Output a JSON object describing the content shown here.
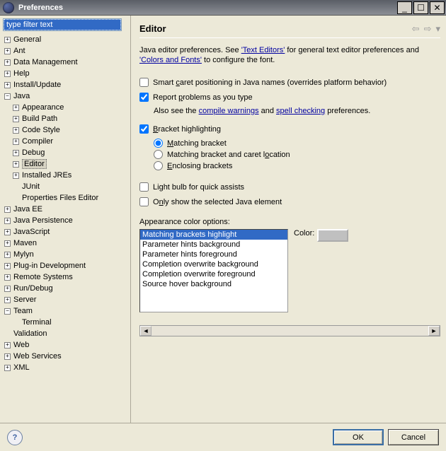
{
  "window": {
    "title": "Preferences"
  },
  "filter": {
    "value": "type filter text"
  },
  "tree": [
    {
      "label": "General",
      "exp": "+",
      "lvl": 0
    },
    {
      "label": "Ant",
      "exp": "+",
      "lvl": 0
    },
    {
      "label": "Data Management",
      "exp": "+",
      "lvl": 0
    },
    {
      "label": "Help",
      "exp": "+",
      "lvl": 0
    },
    {
      "label": "Install/Update",
      "exp": "+",
      "lvl": 0
    },
    {
      "label": "Java",
      "exp": "-",
      "lvl": 0
    },
    {
      "label": "Appearance",
      "exp": "+",
      "lvl": 1
    },
    {
      "label": "Build Path",
      "exp": "+",
      "lvl": 1
    },
    {
      "label": "Code Style",
      "exp": "+",
      "lvl": 1
    },
    {
      "label": "Compiler",
      "exp": "+",
      "lvl": 1
    },
    {
      "label": "Debug",
      "exp": "+",
      "lvl": 1
    },
    {
      "label": "Editor",
      "exp": "+",
      "lvl": 1,
      "selected": true
    },
    {
      "label": "Installed JREs",
      "exp": "+",
      "lvl": 1
    },
    {
      "label": "JUnit",
      "exp": "",
      "lvl": 1
    },
    {
      "label": "Properties Files Editor",
      "exp": "",
      "lvl": 1
    },
    {
      "label": "Java EE",
      "exp": "+",
      "lvl": 0
    },
    {
      "label": "Java Persistence",
      "exp": "+",
      "lvl": 0
    },
    {
      "label": "JavaScript",
      "exp": "+",
      "lvl": 0
    },
    {
      "label": "Maven",
      "exp": "+",
      "lvl": 0
    },
    {
      "label": "Mylyn",
      "exp": "+",
      "lvl": 0
    },
    {
      "label": "Plug-in Development",
      "exp": "+",
      "lvl": 0
    },
    {
      "label": "Remote Systems",
      "exp": "+",
      "lvl": 0
    },
    {
      "label": "Run/Debug",
      "exp": "+",
      "lvl": 0
    },
    {
      "label": "Server",
      "exp": "+",
      "lvl": 0
    },
    {
      "label": "Team",
      "exp": "-",
      "lvl": 0
    },
    {
      "label": "Terminal",
      "exp": "",
      "lvl": 1
    },
    {
      "label": "Validation",
      "exp": "",
      "lvl": 0
    },
    {
      "label": "Web",
      "exp": "+",
      "lvl": 0
    },
    {
      "label": "Web Services",
      "exp": "+",
      "lvl": 0
    },
    {
      "label": "XML",
      "exp": "+",
      "lvl": 0
    }
  ],
  "page": {
    "title": "Editor",
    "desc_prefix": "Java editor preferences. See ",
    "link1": "'Text Editors'",
    "desc_mid": " for general text editor preferences and ",
    "link2": "'Colors and Fonts'",
    "desc_suffix": " to configure the font.",
    "smart_caret": "Smart caret positioning in Java names (overrides platform behavior)",
    "report_problems": "Report problems as you type",
    "also_see_prefix": "Also see the ",
    "link_compile": "compile warnings",
    "also_and": " and ",
    "link_spell": "spell checking",
    "also_suffix": " preferences.",
    "bracket_hl": "Bracket highlighting",
    "radio_match": "Matching bracket",
    "radio_caret": "Matching bracket and caret location",
    "radio_enc": "Enclosing brackets",
    "lightbulb": "Light bulb for quick assists",
    "only_show": "Only show the selected Java element",
    "color_options_label": "Appearance color options:",
    "color_label": "Color:",
    "color_list": [
      "Matching brackets highlight",
      "Parameter hints background",
      "Parameter hints foreground",
      "Completion overwrite background",
      "Completion overwrite foreground",
      "Source hover background"
    ],
    "color_value": "#c0c0c0"
  },
  "buttons": {
    "ok": "OK",
    "cancel": "Cancel"
  },
  "checks": {
    "smart_caret": false,
    "report_problems": true,
    "bracket_hl": true,
    "lightbulb": false,
    "only_show": false
  }
}
